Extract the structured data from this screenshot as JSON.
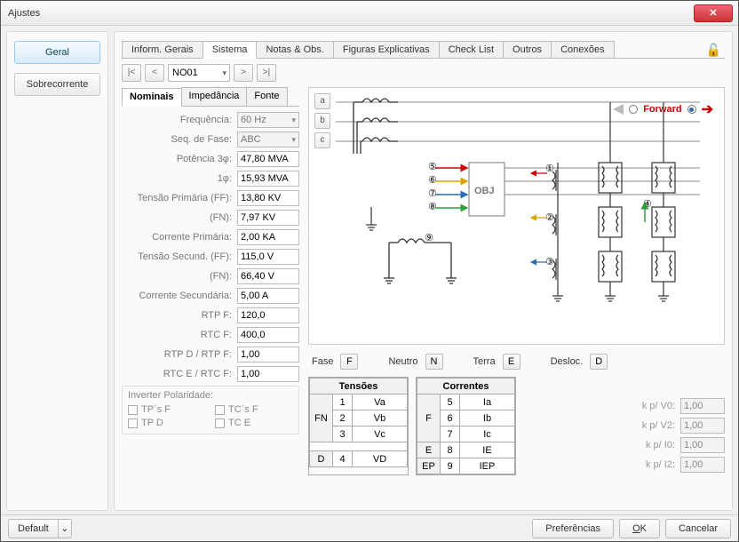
{
  "window": {
    "title": "Ajustes"
  },
  "left_nav": {
    "geral": "Geral",
    "sobrecorrente": "Sobrecorrente"
  },
  "top_tabs": {
    "inform": "Inform. Gerais",
    "sistema": "Sistema",
    "notas": "Notas & Obs.",
    "figuras": "Figuras Explicativas",
    "checklist": "Check List",
    "outros": "Outros",
    "conexoes": "Conexões"
  },
  "record_nav": {
    "first": "|<",
    "prev": "<",
    "current": "NO01",
    "next": ">",
    "last": ">|"
  },
  "sub_tabs": {
    "nominais": "Nominais",
    "impedancia": "Impedância",
    "fonte": "Fonte"
  },
  "form": {
    "frequencia_label": "Frequência:",
    "frequencia": "60 Hz",
    "seqfase_label": "Seq. de Fase:",
    "seqfase": "ABC",
    "pot3_label": "Potência 3φ:",
    "pot3": "47,80 MVA",
    "pot1_label": "1φ:",
    "pot1": "15,93 MVA",
    "tenprimff_label": "Tensão Primária (FF):",
    "tenprimff": "13,80 KV",
    "tenprimfn_label": "(FN):",
    "tenprimfn": "7,97 KV",
    "corprim_label": "Corrente Primária:",
    "corprim": "2,00 KA",
    "tensecff_label": "Tensão Secund. (FF):",
    "tensecff": "115,0 V",
    "tensecfn_label": "(FN):",
    "tensecfn": "66,40 V",
    "corsec_label": "Corrente Secundária:",
    "corsec": "5,00 A",
    "rtpf_label": "RTP F:",
    "rtpf": "120,0",
    "rtcf_label": "RTC F:",
    "rtcf": "400,0",
    "rtpd_label": "RTP D / RTP F:",
    "rtpd": "1,00",
    "rtce_label": "RTC E / RTC F:",
    "rtce": "1,00"
  },
  "polaridade": {
    "header": "Inverter Polaridade:",
    "tpsf": "TP´s F",
    "tcsf": "TC´s F",
    "tpd": "TP D",
    "tce": "TC E"
  },
  "diagram": {
    "phase_a": "a",
    "phase_b": "b",
    "phase_c": "c",
    "forward": "Forward",
    "obj": "OBJ"
  },
  "legend": {
    "fase": "Fase",
    "fase_btn": "F",
    "neutro": "Neutro",
    "neutro_btn": "N",
    "terra": "Terra",
    "terra_btn": "E",
    "desloc": "Desloc.",
    "desloc_btn": "D"
  },
  "tensoes": {
    "title": "Tensões",
    "rows": [
      {
        "grp": "FN",
        "n": "1",
        "v": "Va"
      },
      {
        "grp": "",
        "n": "2",
        "v": "Vb"
      },
      {
        "grp": "",
        "n": "3",
        "v": "Vc"
      }
    ],
    "drow": {
      "grp": "D",
      "n": "4",
      "v": "VD"
    }
  },
  "correntes": {
    "title": "Correntes",
    "rows": [
      {
        "grp": "F",
        "n": "5",
        "v": "Ia"
      },
      {
        "grp": "",
        "n": "6",
        "v": "Ib"
      },
      {
        "grp": "",
        "n": "7",
        "v": "Ic"
      }
    ],
    "erow": {
      "grp": "E",
      "n": "8",
      "v": "IE"
    },
    "eprow": {
      "grp": "EP",
      "n": "9",
      "v": "IEP"
    }
  },
  "kp": {
    "v0_label": "k p/ V0:",
    "v0": "1,00",
    "v2_label": "k p/ V2:",
    "v2": "1,00",
    "i0_label": "k p/ I0:",
    "i0": "1,00",
    "i2_label": "k p/ I2:",
    "i2": "1,00"
  },
  "footer": {
    "default": "Default",
    "prefs": "Preferências",
    "ok": "OK",
    "cancel": "Cancelar"
  }
}
